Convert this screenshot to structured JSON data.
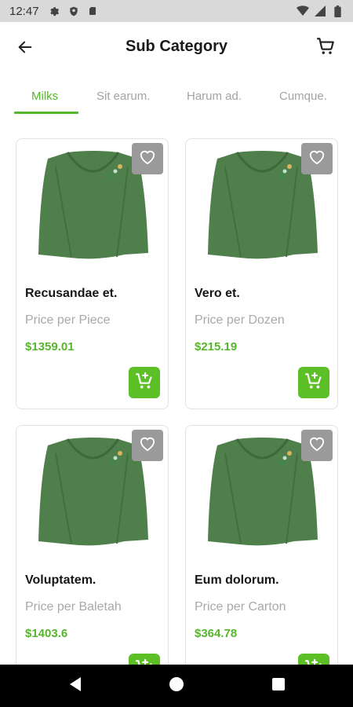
{
  "status_bar": {
    "time": "12:47",
    "icons": [
      "gear-icon",
      "shield-icon",
      "sd-card-icon",
      "wifi-icon",
      "signal-icon",
      "battery-icon"
    ]
  },
  "header": {
    "title": "Sub Category",
    "back_icon": "arrow-left-icon",
    "cart_icon": "cart-icon"
  },
  "tabs": [
    {
      "label": "Milks",
      "active": true
    },
    {
      "label": "Sit earum.",
      "active": false
    },
    {
      "label": "Harum ad.",
      "active": false
    },
    {
      "label": "Cumque.",
      "active": false
    }
  ],
  "colors": {
    "accent": "#56b72c",
    "add_button": "#5cbf26",
    "favorite_button": "#9a9a9a",
    "sweater": "#4f7f4b"
  },
  "products": [
    {
      "name": "Recusandae et.",
      "unit": "Price per Piece",
      "price": "$1359.01"
    },
    {
      "name": "Vero et.",
      "unit": "Price per Dozen",
      "price": "$215.19"
    },
    {
      "name": "Voluptatem.",
      "unit": "Price per Baletah",
      "price": "$1403.6"
    },
    {
      "name": "Eum dolorum.",
      "unit": "Price per Carton",
      "price": "$364.78"
    }
  ],
  "nav_bar": {
    "icons": [
      "back-triangle-icon",
      "home-circle-icon",
      "recents-square-icon"
    ]
  }
}
